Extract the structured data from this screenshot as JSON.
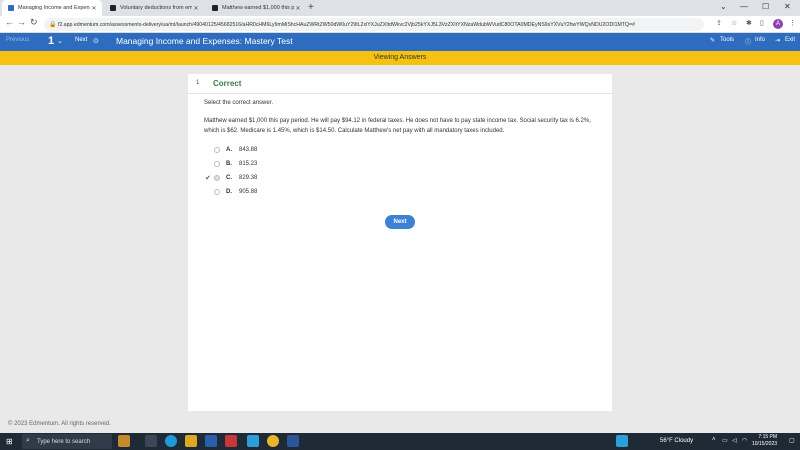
{
  "browser": {
    "tabs": [
      {
        "label": "Managing Income and Expenses",
        "active": true
      },
      {
        "label": "Voluntary deductions from emp",
        "active": false
      },
      {
        "label": "Matthew earned $1,000 this pay",
        "active": false
      }
    ],
    "new_tab": "+",
    "url": "f2.app.edmentum.com/assessments-delivery/ua/mt/launch/49040125/45682516/aHR0cHM6Ly9mMiShcHAuZWRtZW50dW0uY29tL2xlYXJuZXItdWkvc2Vjb25kYXJ5L3VzZXItYXNzaWdubWVudC80OTA0MDEyNS9sYXVuY2hwYWQvNDU2ODI1MTQ=#"
  },
  "app": {
    "previous_label": "Previous",
    "question_number": "1",
    "next_label": "Next",
    "title": "Managing Income and Expenses: Mastery Test",
    "tools_label": "Tools",
    "info_label": "Info",
    "exit_label": "Exit",
    "banner": "Viewing Answers"
  },
  "question": {
    "number": "1",
    "status": "Correct",
    "instruction": "Select the correct answer.",
    "text": "Matthew earned $1,000 this pay period. He will pay $94.12 in federal taxes. He does not have to pay state income tax. Social security tax is 6.2%, which is $62. Medicare is 1.45%, which is $14.50. Calculate Matthew's net pay with all mandatory taxes included.",
    "options": [
      {
        "letter": "A.",
        "value": "843.88"
      },
      {
        "letter": "B.",
        "value": "815.23"
      },
      {
        "letter": "C.",
        "value": "829.38"
      },
      {
        "letter": "D.",
        "value": "905.88"
      }
    ],
    "correct_mark": "✔",
    "next_button": "Next"
  },
  "footer": {
    "copyright": "© 2023 Edmentum. All rights reserved."
  },
  "taskbar": {
    "search_placeholder": "Type here to search",
    "weather": "56°F  Cloudy",
    "time": "7:15 PM",
    "date": "10/15/2023"
  }
}
